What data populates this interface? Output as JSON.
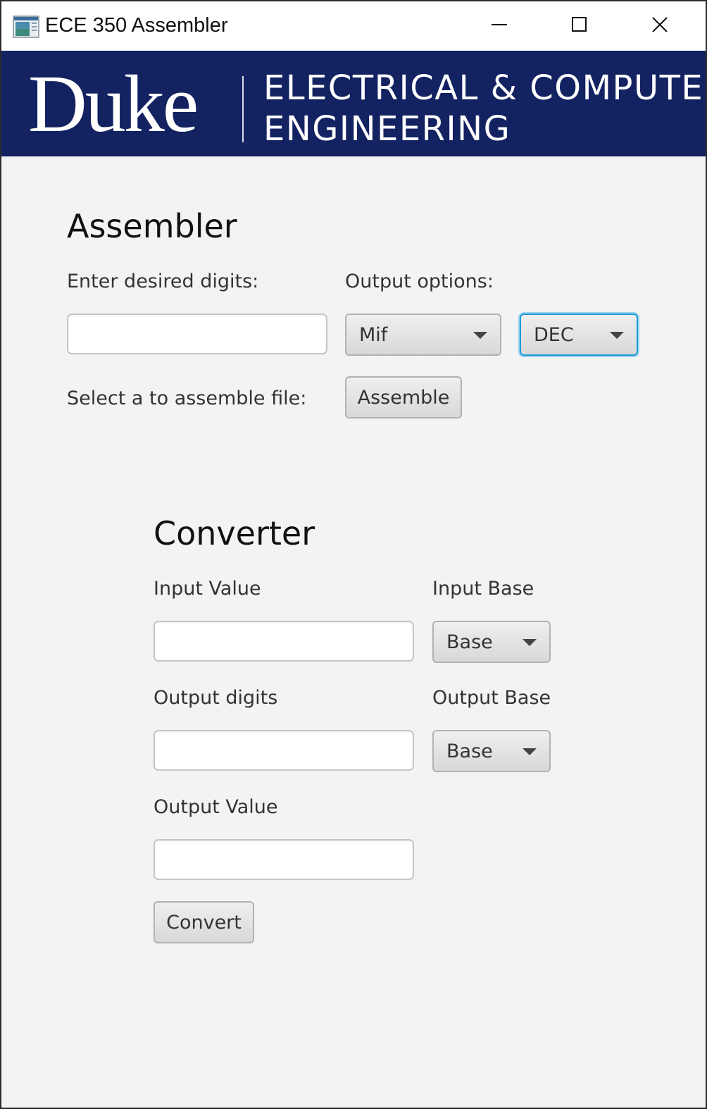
{
  "window": {
    "title": "ECE 350 Assembler",
    "icon": "app-window-icon",
    "controls": {
      "minimize": "minimize-icon",
      "maximize": "maximize-icon",
      "close": "close-icon"
    }
  },
  "banner": {
    "logo_text": "Duke",
    "dept_line1": "ELECTRICAL & COMPUTER",
    "dept_line2": "ENGINEERING",
    "background_color": "#132261"
  },
  "assembler": {
    "heading": "Assembler",
    "digits_label": "Enter desired digits:",
    "digits_value": "",
    "output_options_label": "Output options:",
    "format_select": {
      "selected": "Mif"
    },
    "radix_select": {
      "selected": "DEC"
    },
    "select_file_label": "Select a to assemble file:",
    "assemble_button": "Assemble"
  },
  "converter": {
    "heading": "Converter",
    "input_value_label": "Input Value",
    "input_value": "",
    "input_base_label": "Input Base",
    "input_base_select": {
      "selected": "Base"
    },
    "output_digits_label": "Output digits",
    "output_digits_value": "",
    "output_base_label": "Output Base",
    "output_base_select": {
      "selected": "Base"
    },
    "output_value_label": "Output Value",
    "output_value": "",
    "convert_button": "Convert"
  },
  "colors": {
    "focus_accent": "#1b9cd8",
    "panel_background": "#f3f3f3"
  }
}
